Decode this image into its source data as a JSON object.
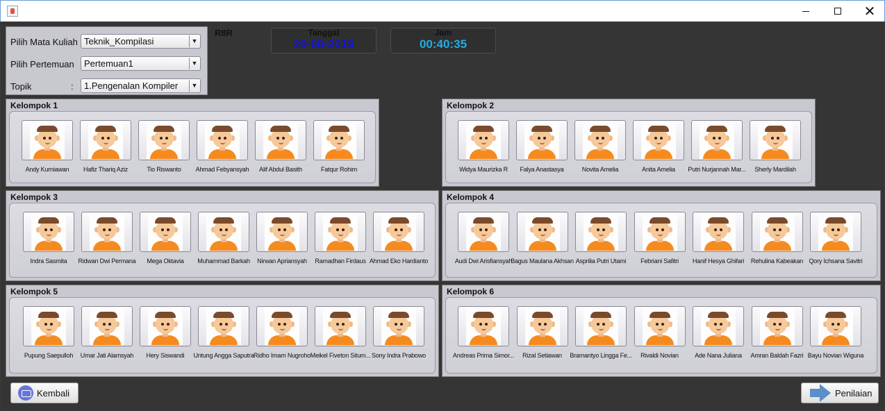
{
  "window": {
    "controls": {
      "minimize": "—",
      "maximize": "☐",
      "close": "✕"
    }
  },
  "selectors": {
    "mata_kuliah": {
      "label": "Pilih Mata Kuliah",
      "value": "Teknik_Kompilasi"
    },
    "pertemuan": {
      "label": "Pilih Pertemuan",
      "value": "Pertemuan1"
    },
    "topik": {
      "label": "Topik",
      "colon": ":",
      "value": "1.Pengenalan Kompiler"
    },
    "arrow": "▼"
  },
  "room": "R8R",
  "date": {
    "caption": "Tanggal",
    "value": "20-08-2019",
    "color": "#1414d8"
  },
  "time": {
    "caption": "Jam",
    "value": "00:40:35",
    "color": "#1eaee6"
  },
  "groups": [
    {
      "title": "Kelompok 1",
      "members": [
        "Andy Kurniawan",
        "Hafiz Thariq Aziz",
        "Tio Riswanto",
        "Ahmad Febyansyah",
        "Alif Abdul Basith",
        "Fatqur Rohim"
      ]
    },
    {
      "title": "Kelompok 2",
      "members": [
        "Widya Maurizka R",
        "Falya Anastasya",
        "Novita Amelia",
        "Anita Amelia",
        "Putri Nurjannah Mar...",
        "Sherly Mardilah"
      ]
    },
    {
      "title": "Kelompok 3",
      "members": [
        "Indra Sasmita",
        "Ridwan Dwi Permana",
        "Mega Oktavia",
        "Muhammad Barkah",
        "Nirwan Apriansyah",
        "Ramadhan Firdaus",
        "Ahmad Eko Hardianto"
      ]
    },
    {
      "title": "Kelompok 4",
      "members": [
        "Audi Dwi Arisfiansyah",
        "Bagus Maulana Akhsan",
        "Asprilia Putri Utami",
        "Febriani Safitri",
        "Hanif Hesya Ghifari",
        "Rehulina Kabeakan",
        "Qory Ichsana Savitri"
      ]
    },
    {
      "title": "Kelompok 5",
      "members": [
        "Pupung Saepulloh",
        "Umar Jati Alamsyah",
        "Hery Siswandi",
        "Untung Angga Saputra",
        "Ridho Imam Nugroho",
        "Meikel Fiveton Situm...",
        "Sony Indra Prabowo"
      ]
    },
    {
      "title": "Kelompok 6",
      "members": [
        "Andreas Prima Simor...",
        "Rizal Setiawan",
        "Bramantyo Lingga Fe...",
        "Rivaldi Novian",
        "Ade Nana Juliana",
        "Amran Baldah Fazri",
        "Bayu Novian Wiguna"
      ]
    }
  ],
  "buttons": {
    "back": "Kembali",
    "next": "Penilaian"
  },
  "icons": {
    "avatar": "student-avatar-icon",
    "back": "back-arrow-icon",
    "next": "forward-arrow-icon"
  }
}
